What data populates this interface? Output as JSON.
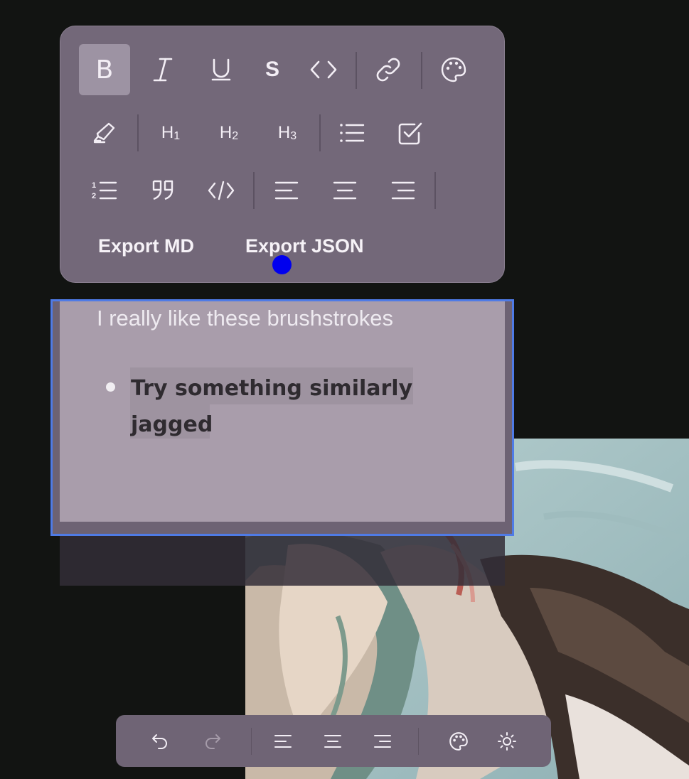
{
  "toolbar": {
    "row1": [
      {
        "name": "bold",
        "glyph": "B",
        "active": true
      },
      {
        "name": "italic",
        "glyph": "I"
      },
      {
        "name": "underline",
        "glyph": "U"
      },
      {
        "name": "strikethrough",
        "glyph": "S"
      },
      {
        "name": "inline-code",
        "glyph": "<>"
      },
      {
        "name": "link",
        "icon": "link-icon"
      },
      {
        "name": "color",
        "icon": "palette-icon"
      }
    ],
    "row2": [
      {
        "name": "highlight",
        "icon": "highlighter-icon"
      },
      {
        "name": "heading-1",
        "glyph": "H",
        "sub": "1"
      },
      {
        "name": "heading-2",
        "glyph": "H",
        "sub": "2"
      },
      {
        "name": "heading-3",
        "glyph": "H",
        "sub": "3"
      },
      {
        "name": "bullet-list",
        "icon": "bullet-list-icon"
      },
      {
        "name": "task-list",
        "icon": "checkbox-icon"
      }
    ],
    "row3": [
      {
        "name": "ordered-list",
        "icon": "ordered-list-icon"
      },
      {
        "name": "blockquote",
        "icon": "quote-icon"
      },
      {
        "name": "code-block",
        "glyph": "</>"
      },
      {
        "name": "align-left",
        "icon": "align-left-icon"
      },
      {
        "name": "align-center",
        "icon": "align-center-icon"
      },
      {
        "name": "align-right",
        "icon": "align-right-icon"
      }
    ],
    "export_md": "Export MD",
    "export_json": "Export JSON"
  },
  "note": {
    "line1": "I really like these brushstrokes",
    "bullet": "Try something similarly jagged"
  },
  "dock": {
    "items": [
      "undo-icon",
      "redo-icon",
      "align-left-icon",
      "align-center-icon",
      "align-right-icon",
      "palette-icon",
      "sun-icon"
    ]
  },
  "colors": {
    "toolbar_bg": "#736879",
    "note_bg": "#a99dab",
    "selection_border": "#4f7be6",
    "cursor": "#0000ee"
  }
}
